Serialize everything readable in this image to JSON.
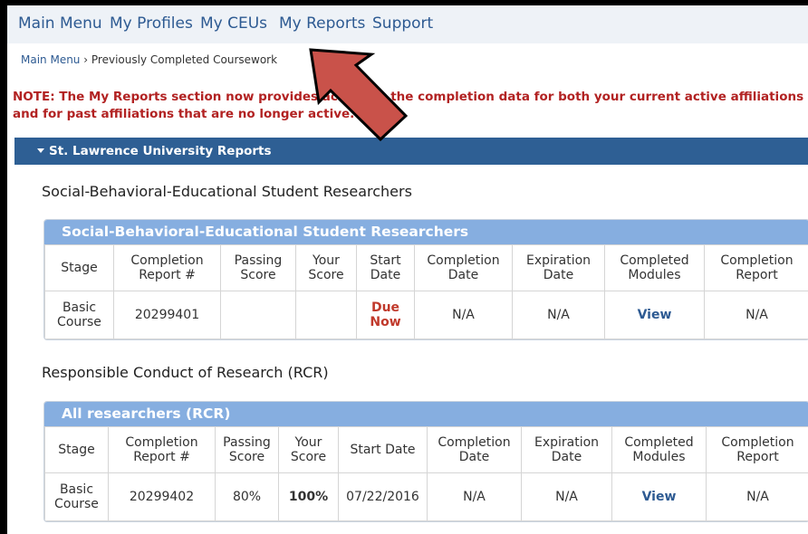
{
  "nav": {
    "items": [
      {
        "label": "Main Menu"
      },
      {
        "label": "My Profiles"
      },
      {
        "label": "My CEUs"
      },
      {
        "label": "My Reports"
      },
      {
        "label": "Support"
      }
    ]
  },
  "breadcrumb": {
    "root": "Main Menu",
    "separator": "›",
    "current": "Previously Completed Coursework"
  },
  "note": {
    "text": "NOTE: The My Reports section now provides access to the completion data for both your current active affiliations and for past affiliations that are no longer active."
  },
  "panel": {
    "title": "St. Lawrence University Reports"
  },
  "columns_a": [
    "Stage",
    "Completion Report #",
    "Passing Score",
    "Your Score",
    "Start Date",
    "Completion Date",
    "Expiration Date",
    "Completed Modules",
    "Completion Report"
  ],
  "columns_b": [
    "Stage",
    "Completion Report #",
    "Passing Score",
    "Your Score",
    "Start Date",
    "Completion Date",
    "Expiration Date",
    "Completed Modules",
    "Completion Report"
  ],
  "sections": [
    {
      "title": "Social-Behavioral-Educational Student Researchers",
      "card_title": "Social-Behavioral-Educational Student Researchers",
      "row": {
        "stage": "Basic Course",
        "report_no": "20299401",
        "passing_score": "",
        "your_score": "",
        "start_date": "Due Now",
        "completion_date": "N/A",
        "expiration_date": "N/A",
        "modules": "View",
        "report": "N/A"
      }
    },
    {
      "title": "Responsible Conduct of Research (RCR)",
      "card_title": "All researchers (RCR)",
      "row": {
        "stage": "Basic Course",
        "report_no": "20299402",
        "passing_score": "80%",
        "your_score": "100%",
        "start_date": "07/22/2016",
        "completion_date": "N/A",
        "expiration_date": "N/A",
        "modules": "View",
        "report": "N/A"
      }
    }
  ],
  "colors": {
    "nav_link": "#2d5a92",
    "note": "#b22222",
    "panel_header": "#2e5f94",
    "card_header": "#86aee0",
    "due": "#c0392b",
    "arrow_fill": "#c9524a"
  },
  "icons": {
    "panel_toggle": "caret-down-icon",
    "annotation": "arrow-icon"
  }
}
